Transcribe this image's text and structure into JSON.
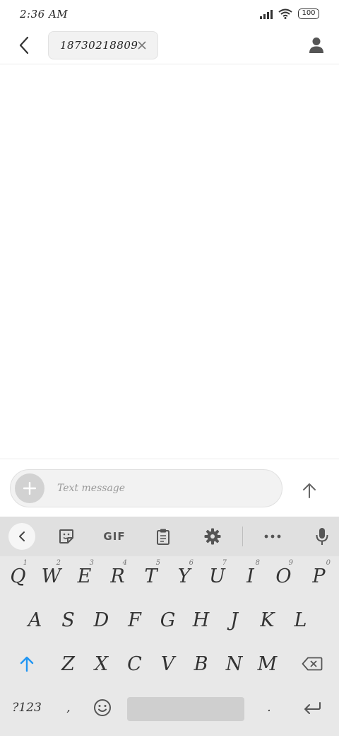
{
  "status_bar": {
    "time": "2:36 AM",
    "battery": "100",
    "icons": [
      "signal-icon",
      "wifi-icon",
      "battery-icon"
    ]
  },
  "header": {
    "back_icon": "chevron-left-icon",
    "recipient": "18730218809",
    "remove_icon": "close-icon",
    "contact_icon": "person-icon"
  },
  "compose": {
    "attach_icon": "plus-icon",
    "placeholder": "Text message",
    "value": "",
    "send_icon": "arrow-up-icon"
  },
  "keyboard": {
    "toolbar": {
      "collapse_icon": "chevron-left-icon",
      "sticker_icon": "sticker-icon",
      "gif_label": "GIF",
      "clipboard_icon": "clipboard-icon",
      "settings_icon": "gear-icon",
      "more_icon": "more-horizontal-icon",
      "mic_icon": "microphone-icon"
    },
    "row1": [
      {
        "label": "Q",
        "hint": "1"
      },
      {
        "label": "W",
        "hint": "2"
      },
      {
        "label": "E",
        "hint": "3"
      },
      {
        "label": "R",
        "hint": "4"
      },
      {
        "label": "T",
        "hint": "5"
      },
      {
        "label": "Y",
        "hint": "6"
      },
      {
        "label": "U",
        "hint": "7"
      },
      {
        "label": "I",
        "hint": "8"
      },
      {
        "label": "O",
        "hint": "9"
      },
      {
        "label": "P",
        "hint": "0"
      }
    ],
    "row2": [
      "A",
      "S",
      "D",
      "F",
      "G",
      "H",
      "J",
      "K",
      "L"
    ],
    "row3": [
      "Z",
      "X",
      "C",
      "V",
      "B",
      "N",
      "M"
    ],
    "shift_icon": "shift-arrow-icon",
    "backspace_icon": "backspace-icon",
    "symbols_label": "?123",
    "comma": ",",
    "emoji_icon": "emoji-icon",
    "period": ".",
    "enter_icon": "enter-icon"
  },
  "colors": {
    "accent": "#2196f3",
    "keyboard_bg": "#e8e8e8",
    "toolbar_bg": "#e0e0e0",
    "chip_bg": "#f2f2f2"
  }
}
